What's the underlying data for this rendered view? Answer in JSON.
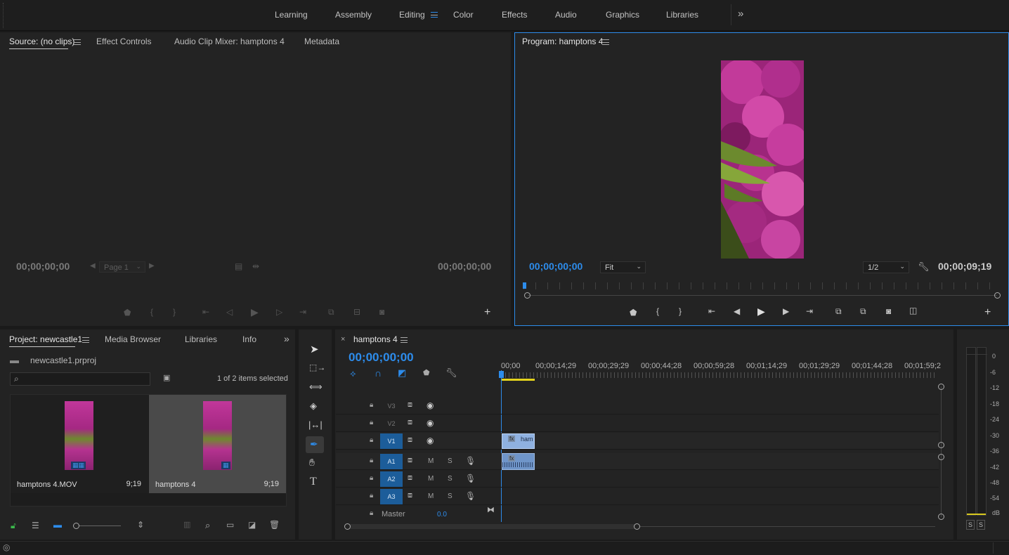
{
  "workspaces": {
    "items": [
      "Learning",
      "Assembly",
      "Editing",
      "Color",
      "Effects",
      "Audio",
      "Graphics",
      "Libraries"
    ],
    "active": "Editing"
  },
  "source_panel": {
    "tabs": [
      "Source: (no clips)",
      "Effect Controls",
      "Audio Clip Mixer: hamptons 4",
      "Metadata"
    ],
    "timecode_in": "00;00;00;00",
    "timecode_out": "00;00;00;00",
    "page_select": "Page 1"
  },
  "program_panel": {
    "title": "Program: hamptons 4",
    "timecode_current": "00;00;00;00",
    "fit_select": "Fit",
    "resolution_select": "1/2",
    "timecode_duration": "00;00;09;19"
  },
  "project_panel": {
    "tabs": [
      "Project: newcastle1",
      "Media Browser",
      "Libraries",
      "Info"
    ],
    "project_file": "newcastle1.prproj",
    "search_placeholder": "",
    "selection_status": "1 of 2 items selected",
    "items": [
      {
        "name": "hamptons 4.MOV",
        "duration": "9;19",
        "selected": false
      },
      {
        "name": "hamptons 4",
        "duration": "9;19",
        "selected": true
      }
    ]
  },
  "timeline": {
    "tab": "hamptons 4",
    "timecode": "00;00;00;00",
    "ruler": [
      "00;00",
      "00;00;14;29",
      "00;00;29;29",
      "00;00;44;28",
      "00;00;59;28",
      "00;01;14;29",
      "00;01;29;29",
      "00;01;44;28",
      "00;01;59;2"
    ],
    "video_tracks": [
      "V3",
      "V2",
      "V1"
    ],
    "audio_tracks": [
      "A1",
      "A2",
      "A3"
    ],
    "mute_label": "M",
    "solo_label": "S",
    "master_label": "Master",
    "master_value": "0.0",
    "clip_label": "ham"
  },
  "audio_meter": {
    "scale": [
      "0",
      "-6",
      "-12",
      "-18",
      "-24",
      "-30",
      "-36",
      "-42",
      "-48",
      "-54",
      "dB"
    ],
    "solo_buttons": [
      "S",
      "S"
    ]
  },
  "colors": {
    "accent": "#2d8ceb",
    "panel": "#232323",
    "background": "#1a1a1a",
    "clip_video": "#8fb1e0",
    "clip_audio": "#6f95c9"
  }
}
